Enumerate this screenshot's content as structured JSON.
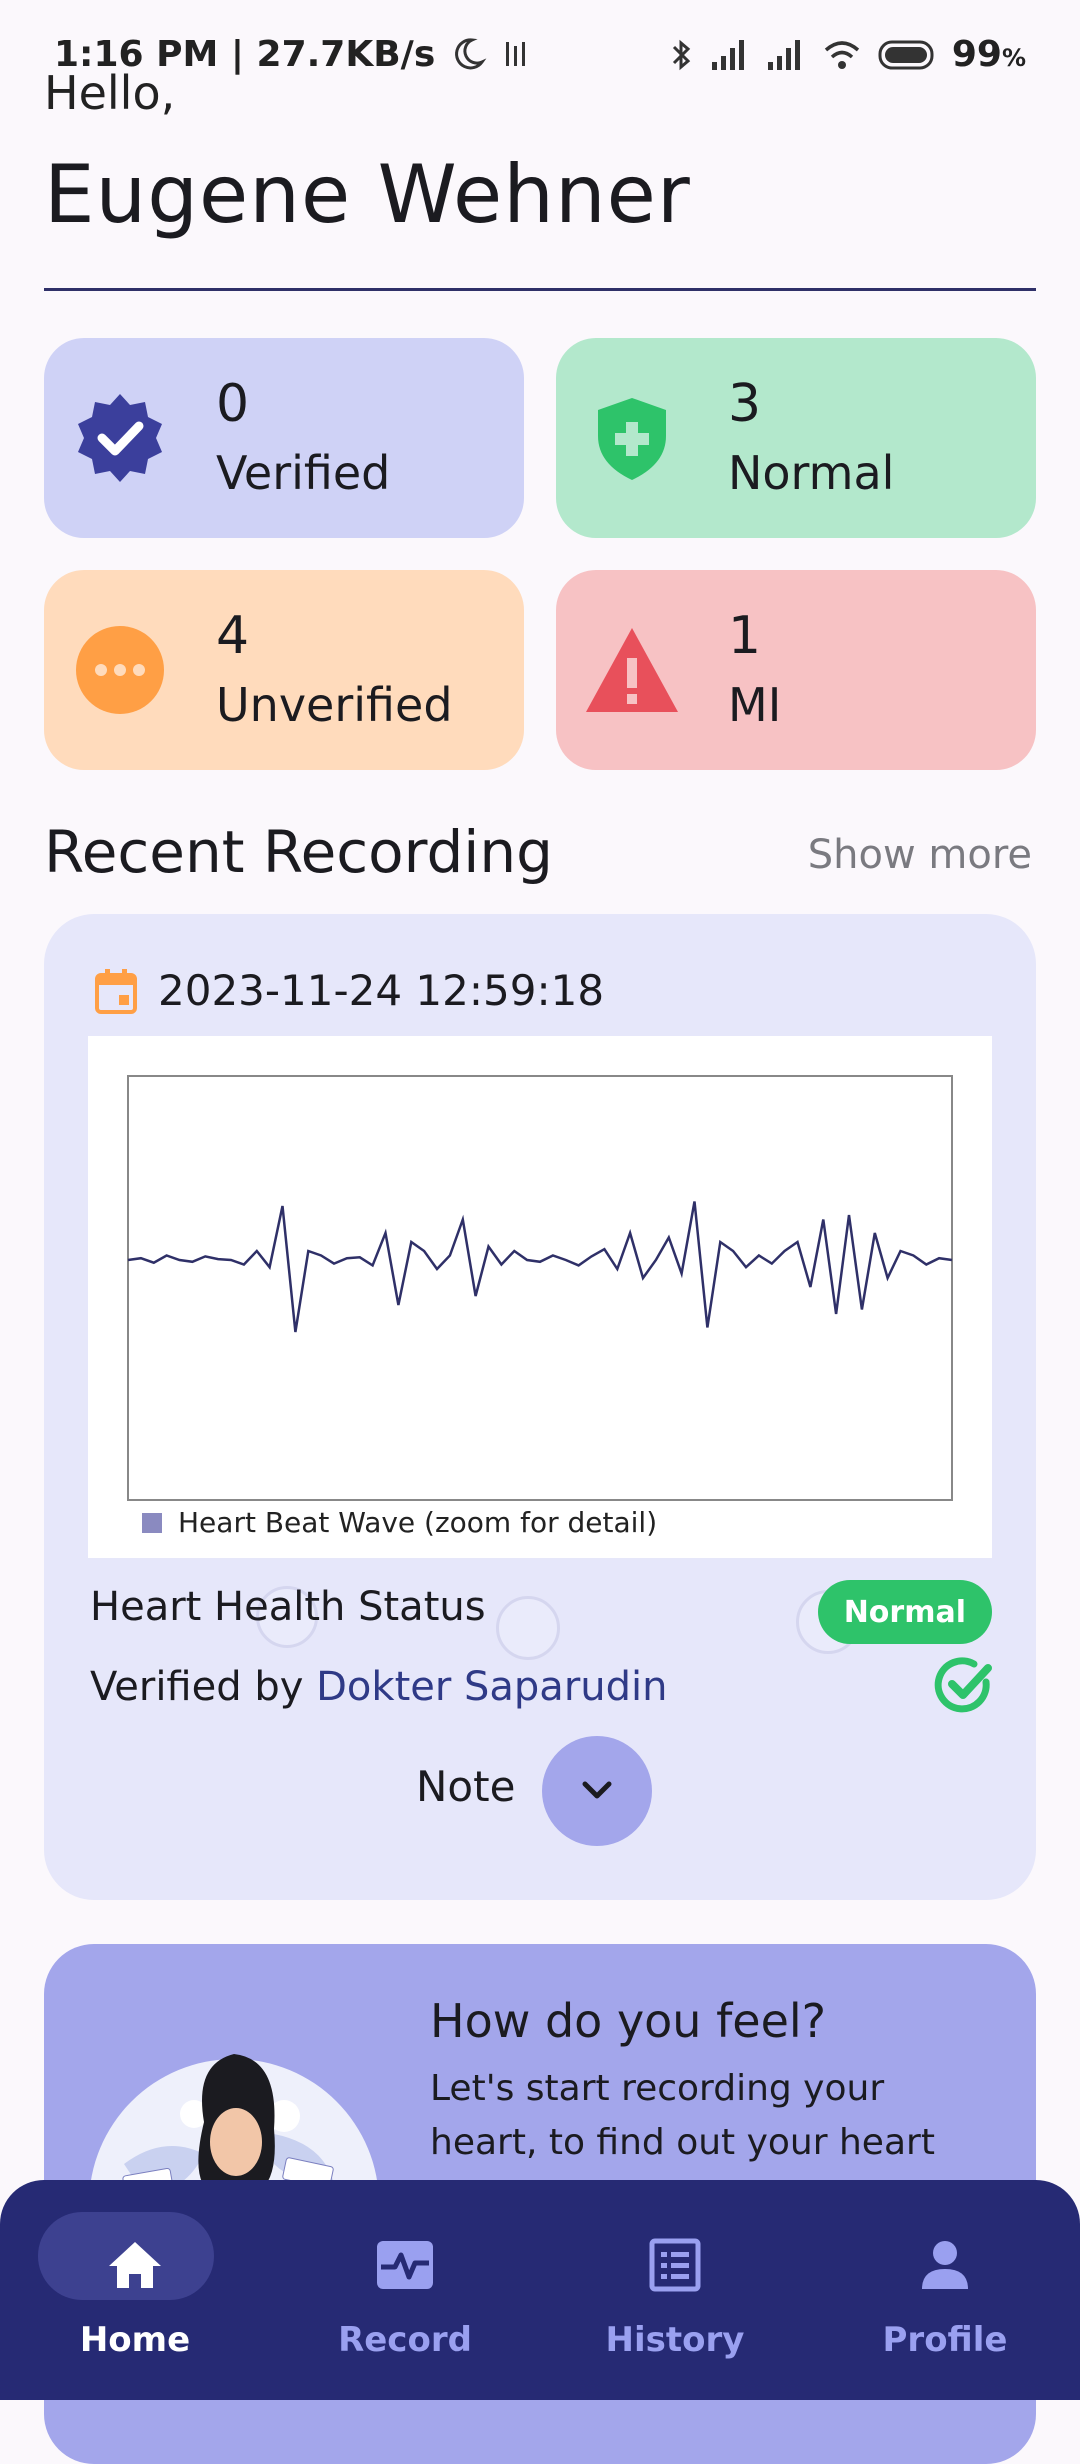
{
  "status_bar": {
    "time": "1:16 PM",
    "speed": "27.7KB/s",
    "battery": "99"
  },
  "greeting": {
    "hello": "Hello,",
    "name": "Eugene Wehner"
  },
  "stats": [
    {
      "count": "0",
      "label": "Verified",
      "icon": "badge-check-icon",
      "bg": "#cfd2f6",
      "icon_color": "#3b3f9c"
    },
    {
      "count": "3",
      "label": "Normal",
      "icon": "shield-plus-icon",
      "bg": "#b3e8cc",
      "icon_color": "#2ec36a"
    },
    {
      "count": "4",
      "label": "Unverified",
      "icon": "dots-circle-icon",
      "bg": "#ffdbbc",
      "icon_color": "#ff9f45"
    },
    {
      "count": "1",
      "label": "MI",
      "icon": "warning-triangle-icon",
      "bg": "#f7c2c4",
      "icon_color": "#e8505b"
    }
  ],
  "recent": {
    "title": "Recent Recording",
    "show_more": "Show more",
    "date": "2023-11-24 12:59:18",
    "legend": "Heart Beat Wave (zoom for detail)",
    "status_label": "Heart Health Status",
    "status_value": "Normal",
    "verified_prefix": "Verified by",
    "verified_by": "Dokter Saparudin",
    "note_label": "Note"
  },
  "feel": {
    "title": "How do you feel?",
    "text": "Let's start recording your heart, to find out your heart"
  },
  "nav": [
    {
      "label": "Home",
      "icon": "home-icon",
      "active": true
    },
    {
      "label": "Record",
      "icon": "heartbeat-icon",
      "active": false
    },
    {
      "label": "History",
      "icon": "list-icon",
      "active": false
    },
    {
      "label": "Profile",
      "icon": "person-icon",
      "active": false
    }
  ],
  "colors": {
    "accent": "#262a74",
    "normal_green": "#2ec36a",
    "wave": "#2f3068"
  },
  "chart_data": {
    "type": "line",
    "series": [
      {
        "name": "Heart Beat Wave (zoom for detail)",
        "values": [
          0,
          0.02,
          -0.03,
          0.05,
          0,
          -0.02,
          0.04,
          0.01,
          0,
          -0.05,
          0.1,
          -0.08,
          0.6,
          -0.8,
          0.1,
          0.05,
          -0.04,
          0.02,
          0.03,
          -0.06,
          0.3,
          -0.5,
          0.2,
          0.1,
          -0.1,
          0.05,
          0.45,
          -0.4,
          0.15,
          -0.05,
          0.1,
          0,
          -0.02,
          0.05,
          0.0,
          -0.06,
          0.04,
          0.12,
          -0.1,
          0.3,
          -0.2,
          0.0,
          0.25,
          -0.15,
          0.65,
          -0.75,
          0.2,
          0.1,
          -0.08,
          0.05,
          -0.04,
          0.1,
          0.2,
          -0.3,
          0.45,
          -0.6,
          0.5,
          -0.55,
          0.3,
          -0.2,
          0.1,
          0.05,
          -0.05,
          0.02,
          0.0
        ]
      }
    ]
  }
}
